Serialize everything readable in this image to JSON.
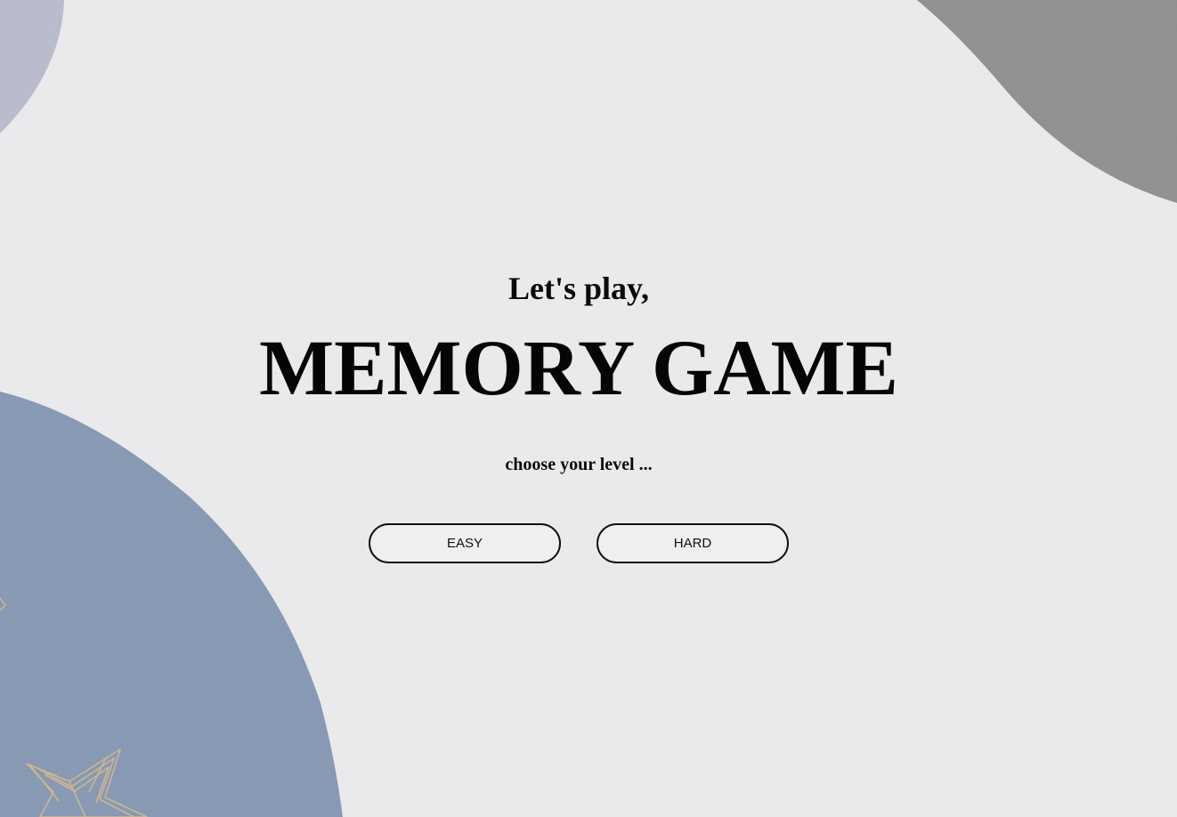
{
  "screen": {
    "greeting": "Let's play,",
    "title": "MEMORY GAME",
    "prompt": "choose your level ..."
  },
  "levels": {
    "easy_label": "EASY",
    "hard_label": "HARD"
  },
  "theme": {
    "background": "#ececee",
    "slate_blue_blob": "#8598b4",
    "lavender_blob": "#b9bccd",
    "gray_blob": "#8e8f91",
    "star_gold": "#d8b98c",
    "text": "#0a0a0a"
  }
}
